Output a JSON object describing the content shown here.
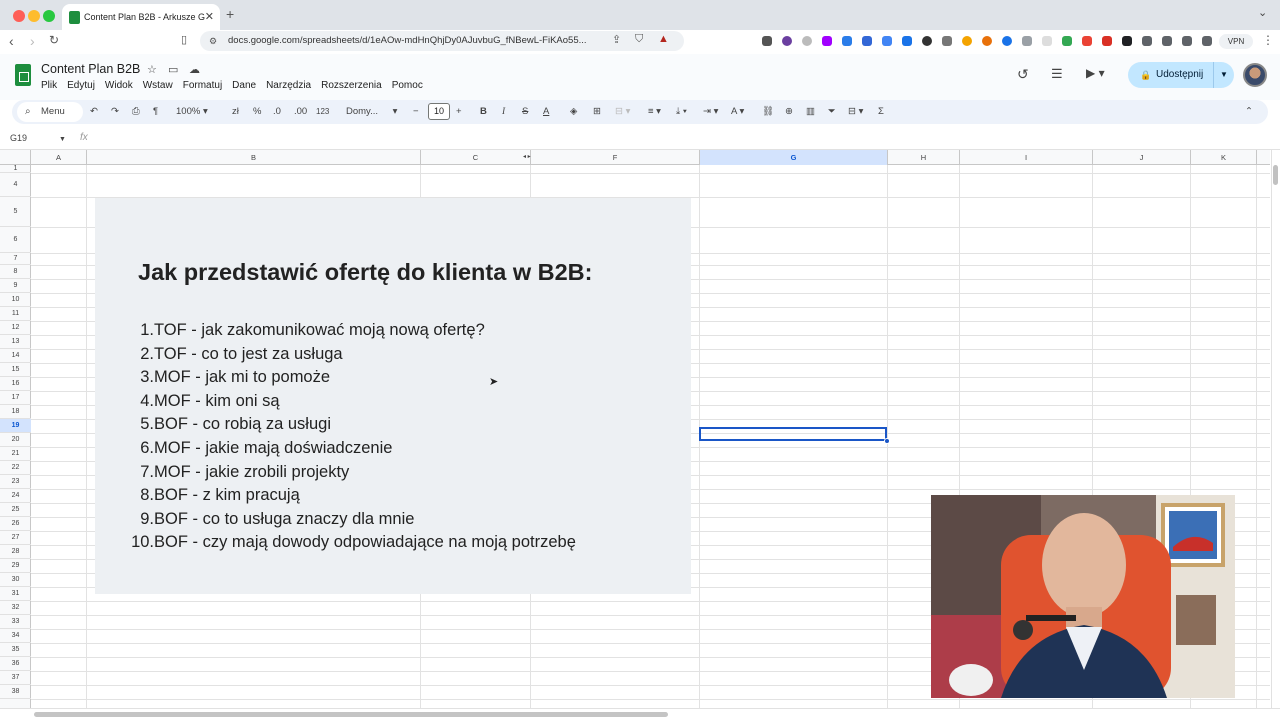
{
  "browser": {
    "tab_title": "Content Plan B2B - Arkusze Google",
    "tab_title_visible": "Content Plan B2B - Arkusze G",
    "url": "docs.google.com/spreadsheets/d/1eAOw-mdHnQhjDy0AJuvbuG_fNBewL-FiKAo55...",
    "vpn_label": "VPN"
  },
  "app": {
    "title": "Content Plan B2B",
    "menu": [
      "Plik",
      "Edytuj",
      "Widok",
      "Wstaw",
      "Formatuj",
      "Dane",
      "Narzędzia",
      "Rozszerzenia",
      "Pomoc"
    ],
    "share_label": "Udostępnij"
  },
  "toolbar": {
    "search_label": "Menu",
    "zoom": "100%",
    "currency": "zł",
    "percent": "%",
    "dec_less": ".0",
    "dec_more": ".00",
    "number_format": "123",
    "font": "Domy...",
    "font_size": "10"
  },
  "formula_bar": {
    "cell_ref": "G19",
    "fx": "fx",
    "value": ""
  },
  "sheet": {
    "columns": [
      "A",
      "B",
      "C",
      "F",
      "G",
      "H",
      "I",
      "J",
      "K"
    ],
    "selected_column": "G",
    "rows": [
      "1",
      "4",
      "5",
      "6",
      "7",
      "8",
      "9",
      "10",
      "11",
      "12",
      "13",
      "14",
      "15",
      "16",
      "17",
      "18",
      "19",
      "20",
      "21",
      "22",
      "23",
      "24",
      "25",
      "26",
      "27",
      "28",
      "29",
      "30",
      "31",
      "32",
      "33",
      "34",
      "35",
      "36",
      "37",
      "38"
    ],
    "selected_row": "19"
  },
  "content": {
    "heading": "Jak przedstawić ofertę do klienta w B2B:",
    "items": [
      {
        "num": "1.",
        "text": "TOF - jak zakomunikować moją nową ofertę?"
      },
      {
        "num": "2.",
        "text": "TOF - co to jest za usługa"
      },
      {
        "num": "3.",
        "text": "MOF - jak mi to pomoże"
      },
      {
        "num": "4.",
        "text": "MOF - kim oni są"
      },
      {
        "num": "5.",
        "text": "BOF - co robią za usługi"
      },
      {
        "num": "6.",
        "text": "MOF - jakie mają doświadczenie"
      },
      {
        "num": "7.",
        "text": "MOF - jakie zrobili projekty"
      },
      {
        "num": "8.",
        "text": "BOF - z kim pracują"
      },
      {
        "num": "9.",
        "text": "BOF - co to usługa znaczy dla mnie"
      },
      {
        "num": "10.",
        "text": "BOF - czy mają dowody odpowiadające na moją potrzebę"
      }
    ]
  },
  "colors": {
    "accent": "#1a56c7",
    "sheets_green": "#1e8e3e",
    "panel_bg": "#edf0f3",
    "share_bg": "#c2e7ff"
  }
}
